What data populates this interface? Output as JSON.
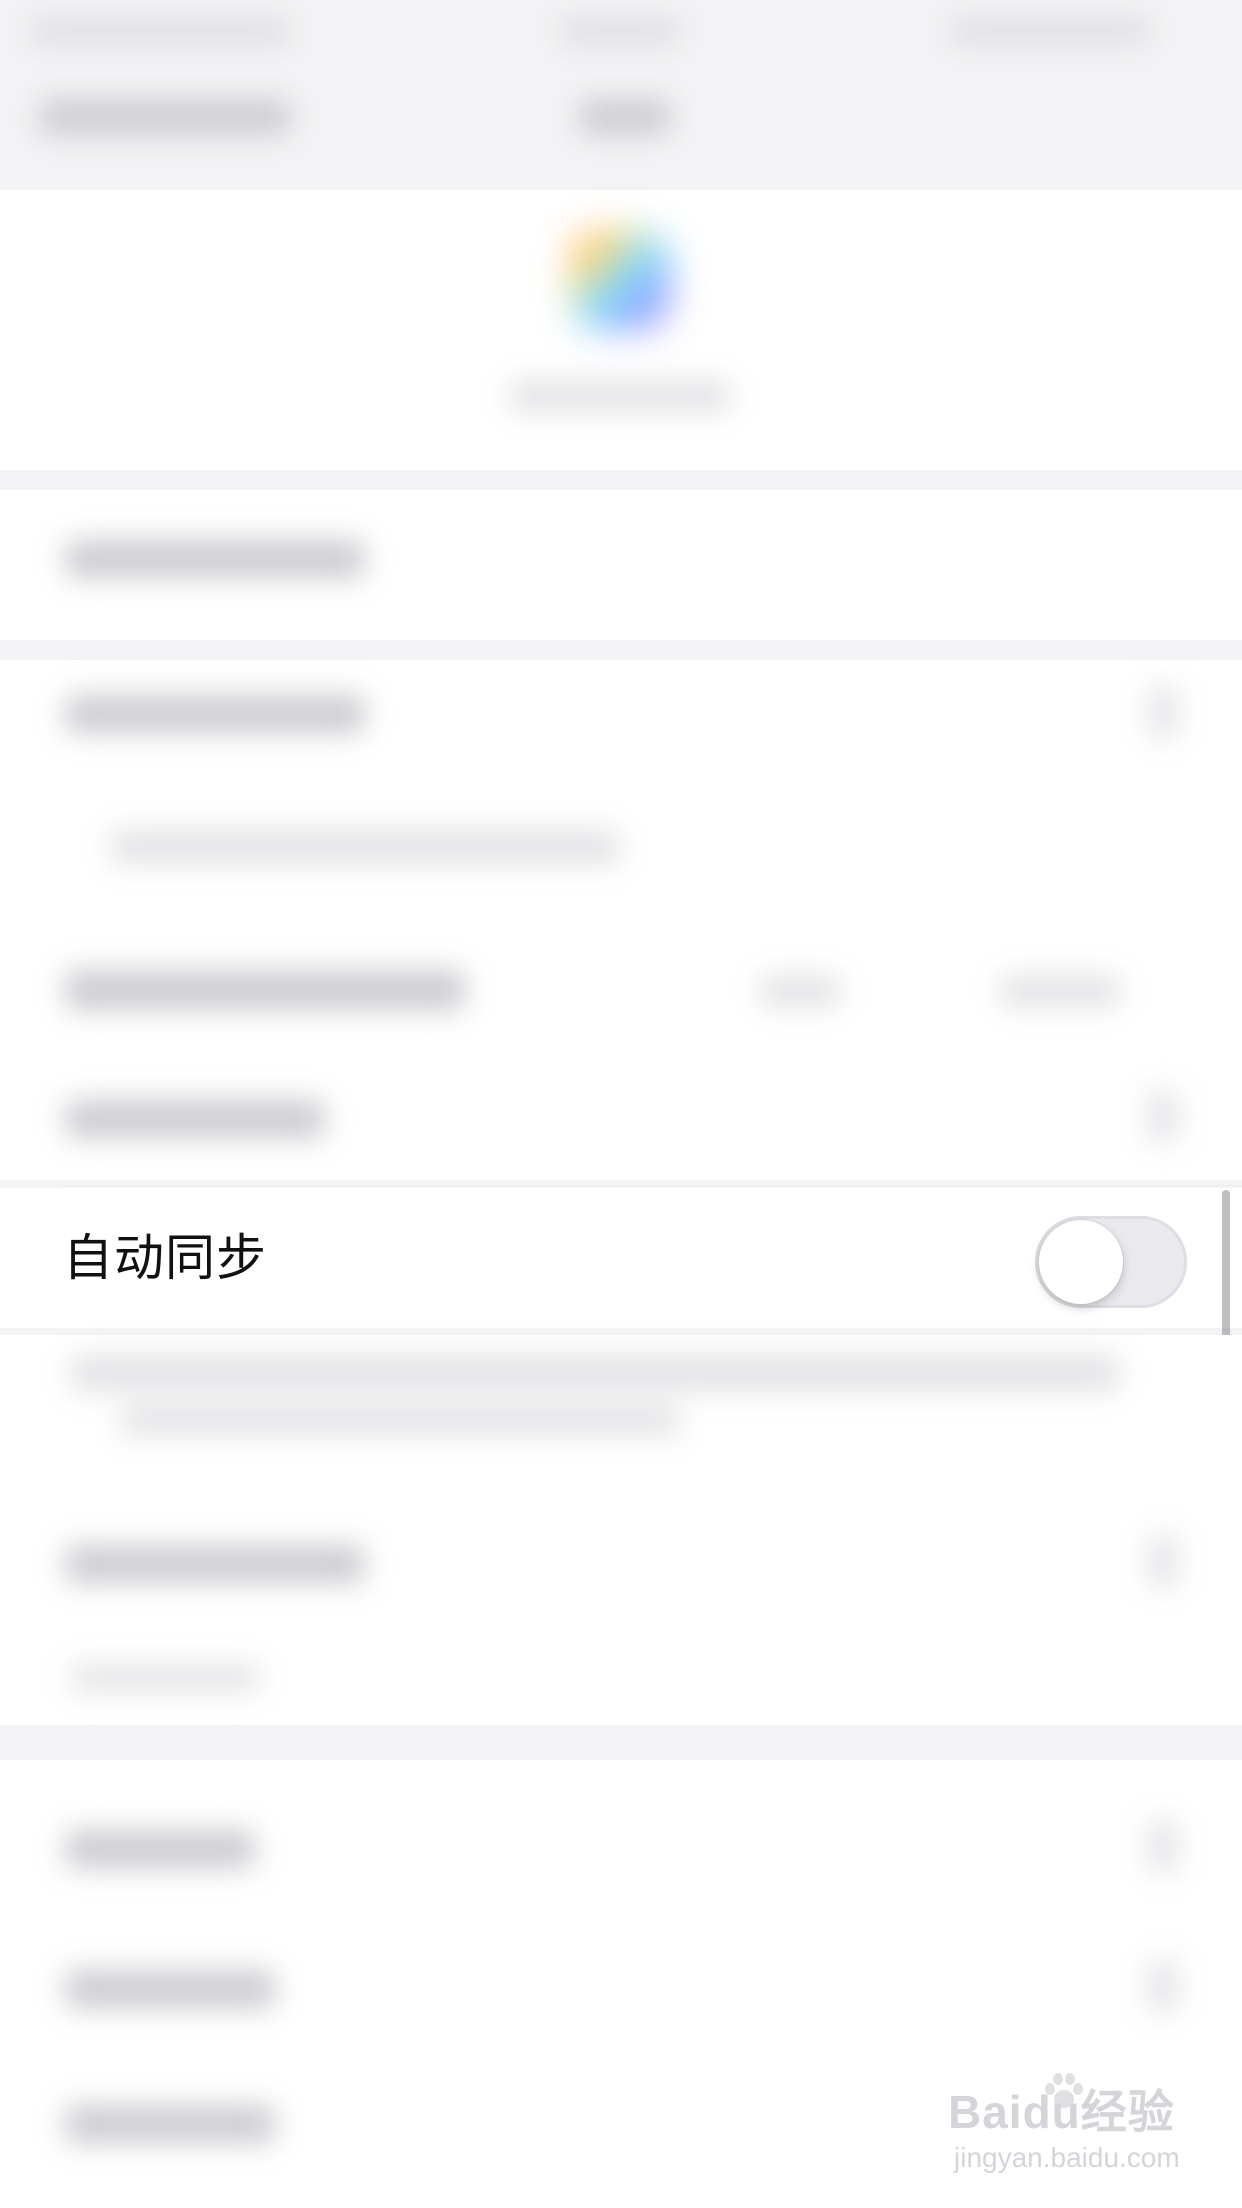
{
  "settings": {
    "auto_sync_label": "自动同步",
    "auto_sync_enabled": false
  },
  "watermark": {
    "brand": "Baidu经验",
    "url": "jingyan.baidu.com"
  },
  "colors": {
    "toggle_off_track": "#e9e9ee",
    "toggle_knob": "#ffffff",
    "page_bg": "#f4f4f6"
  },
  "icons": {
    "app_logo": "gradient-app-logo-icon",
    "watermark_logo": "baidu-paw-icon"
  }
}
